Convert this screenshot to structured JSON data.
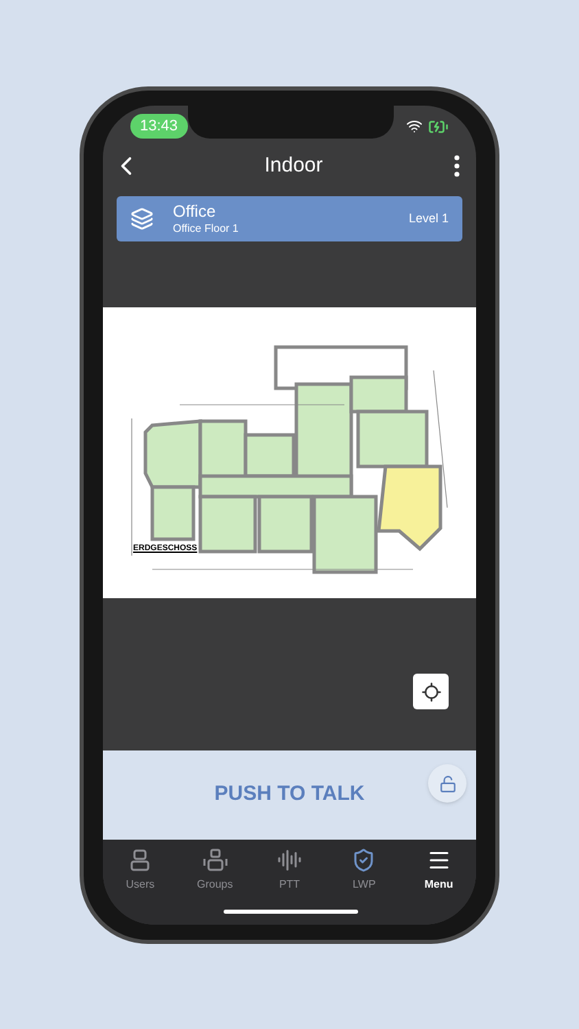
{
  "status_bar": {
    "time": "13:43"
  },
  "header": {
    "title": "Indoor"
  },
  "floor_card": {
    "name": "Office",
    "subtitle": "Office Floor 1",
    "level": "Level 1"
  },
  "map": {
    "plan_label": "ERDGESCHOSS"
  },
  "ptt": {
    "label": "PUSH TO TALK"
  },
  "tabs": [
    {
      "label": "Users",
      "kind": "users",
      "selected": false
    },
    {
      "label": "Groups",
      "kind": "groups",
      "selected": false
    },
    {
      "label": "PTT",
      "kind": "ptt",
      "selected": false
    },
    {
      "label": "LWP",
      "kind": "lwp",
      "selected": false
    },
    {
      "label": "Menu",
      "kind": "menu",
      "selected": true
    }
  ]
}
